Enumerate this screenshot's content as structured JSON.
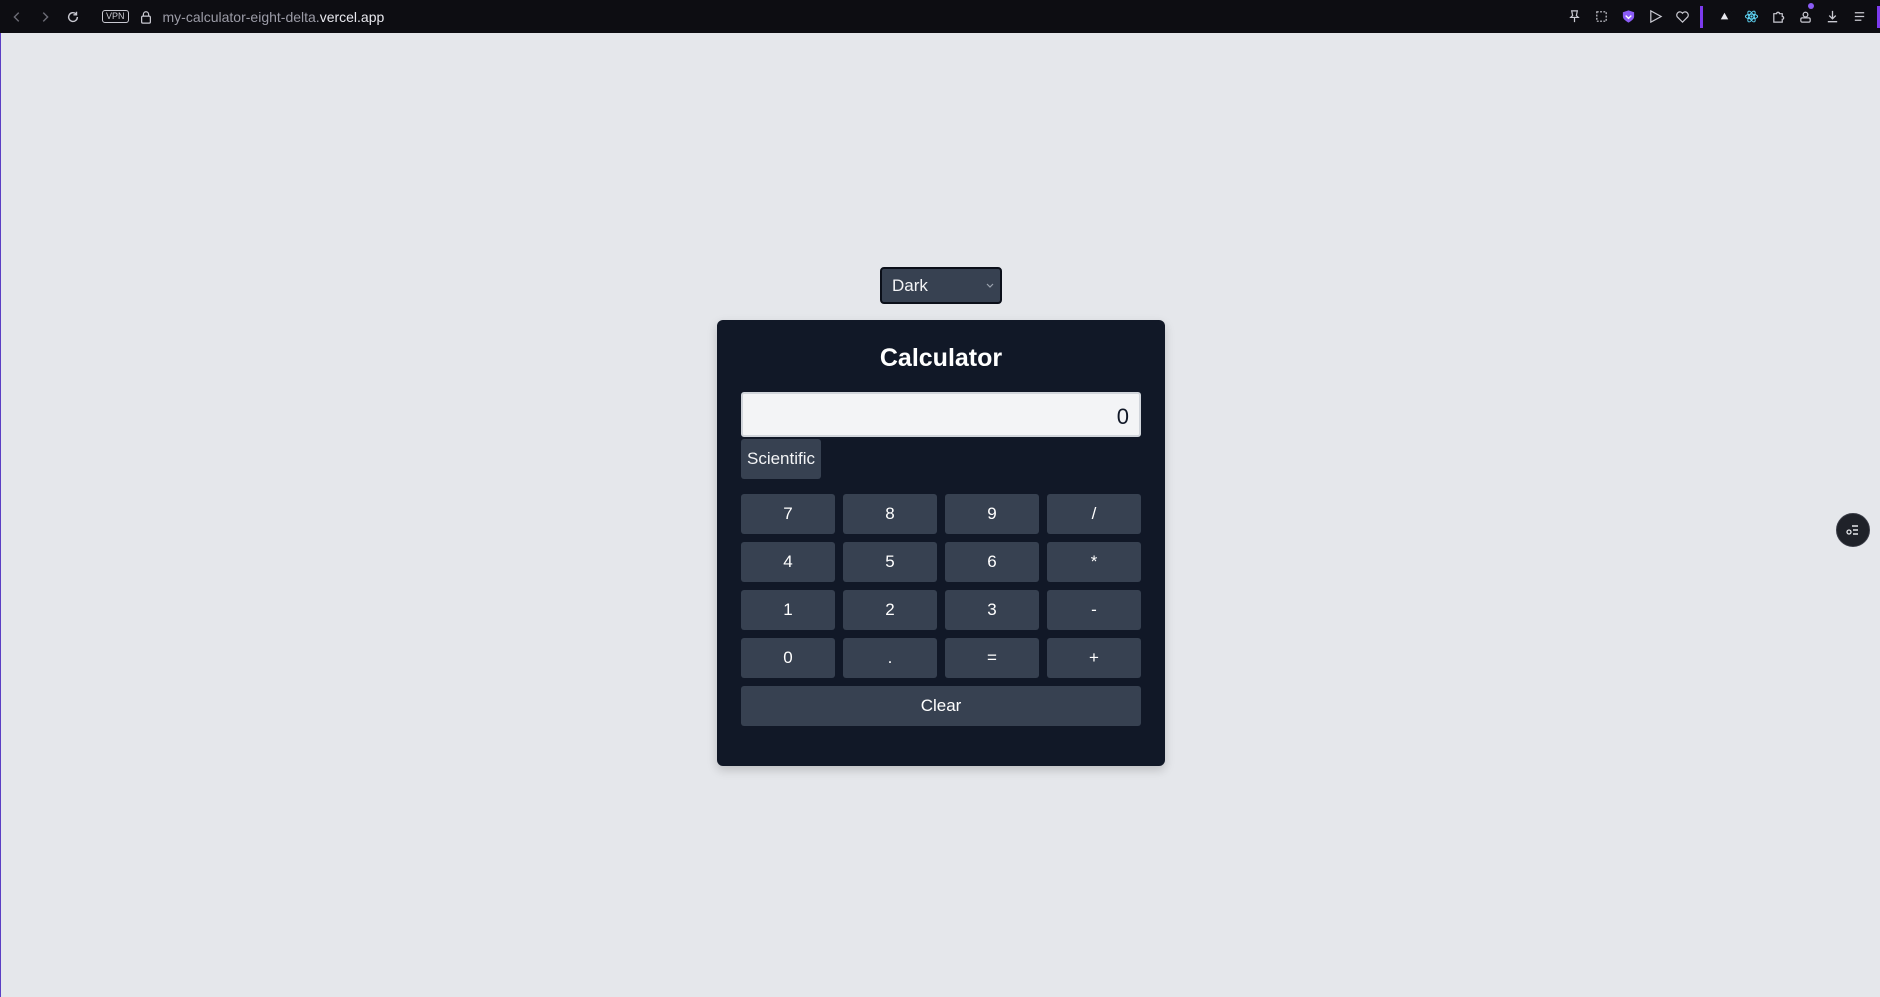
{
  "browser": {
    "vpn_label": "VPN",
    "url_path": "my-calculator-eight-delta.",
    "url_host": "vercel.app"
  },
  "theme_select": {
    "selected": "Dark"
  },
  "calculator": {
    "title": "Calculator",
    "display_value": "0",
    "scientific_label": "Scientific",
    "keys": [
      "7",
      "8",
      "9",
      "/",
      "4",
      "5",
      "6",
      "*",
      "1",
      "2",
      "3",
      "-",
      "0",
      ".",
      "=",
      "+"
    ],
    "clear_label": "Clear"
  },
  "colors": {
    "page_bg": "#e5e7eb",
    "calc_bg": "#111827",
    "key_bg": "#374151",
    "display_bg": "#f3f4f6",
    "accent": "#7c3aed"
  }
}
